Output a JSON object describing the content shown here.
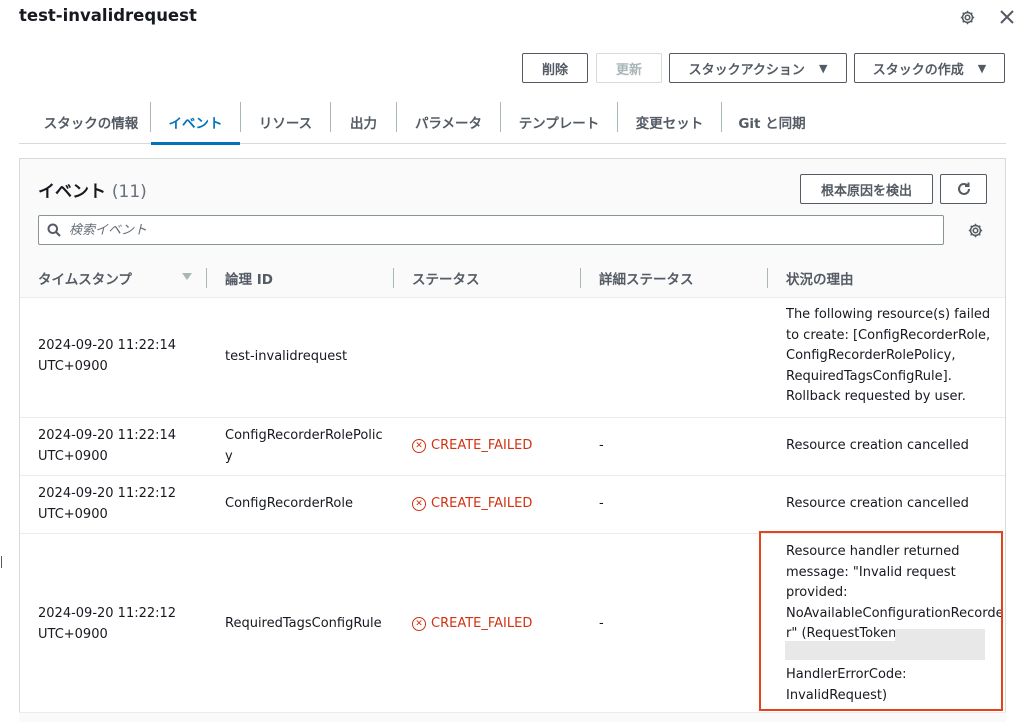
{
  "header": {
    "title": "test-invalidrequest",
    "settings_icon": "gear-icon",
    "close_icon": "close-icon"
  },
  "actions": {
    "delete_label": "削除",
    "update_label": "更新",
    "stack_actions_label": "スタックアクション",
    "create_stack_label": "スタックの作成"
  },
  "tabs": [
    {
      "label": "スタックの情報"
    },
    {
      "label": "イベント",
      "active": true
    },
    {
      "label": "リソース"
    },
    {
      "label": "出力"
    },
    {
      "label": "パラメータ"
    },
    {
      "label": "テンプレート"
    },
    {
      "label": "変更セット"
    },
    {
      "label": "Git と同期"
    }
  ],
  "events": {
    "title": "イベント",
    "count": "(11)",
    "root_cause_label": "根本原因を検出",
    "search_placeholder": "検索イベント",
    "columns": [
      "タイムスタンプ",
      "論理 ID",
      "ステータス",
      "詳細ステータス",
      "状況の理由"
    ],
    "rows": [
      {
        "timestamp_date": "2024-09-20 11:22:14",
        "timestamp_tz": "UTC+0900",
        "logical_id": "test-invalidrequest",
        "status": "",
        "detail": "",
        "reason": [
          "The following resource(s) failed",
          "to create: [ConfigRecorderRole,",
          "ConfigRecorderRolePolicy,",
          "RequiredTagsConfigRule].",
          "Rollback requested by user."
        ]
      },
      {
        "timestamp_date": "2024-09-20 11:22:14",
        "timestamp_tz": "UTC+0900",
        "logical_id": [
          "ConfigRecorderRolePolic",
          "y"
        ],
        "status": "CREATE_FAILED",
        "detail": "-",
        "reason": [
          "Resource creation cancelled"
        ]
      },
      {
        "timestamp_date": "2024-09-20 11:22:12",
        "timestamp_tz": "UTC+0900",
        "logical_id": "ConfigRecorderRole",
        "status": "CREATE_FAILED",
        "detail": "-",
        "reason": [
          "Resource creation cancelled"
        ]
      },
      {
        "timestamp_date": "2024-09-20 11:22:12",
        "timestamp_tz": "UTC+0900",
        "logical_id": "RequiredTagsConfigRule",
        "status": "CREATE_FAILED",
        "detail": "-",
        "reason": [
          "Resource handler returned",
          "message: \"Invalid request",
          "provided:",
          "NoAvailableConfigurationRecorde",
          "r\" (RequestToken:",
          "HandlerErrorCode:",
          "InvalidRequest)"
        ]
      }
    ]
  },
  "colors": {
    "accent": "#0073bb",
    "error": "#d13212",
    "highlight_border": "#e5421e"
  }
}
